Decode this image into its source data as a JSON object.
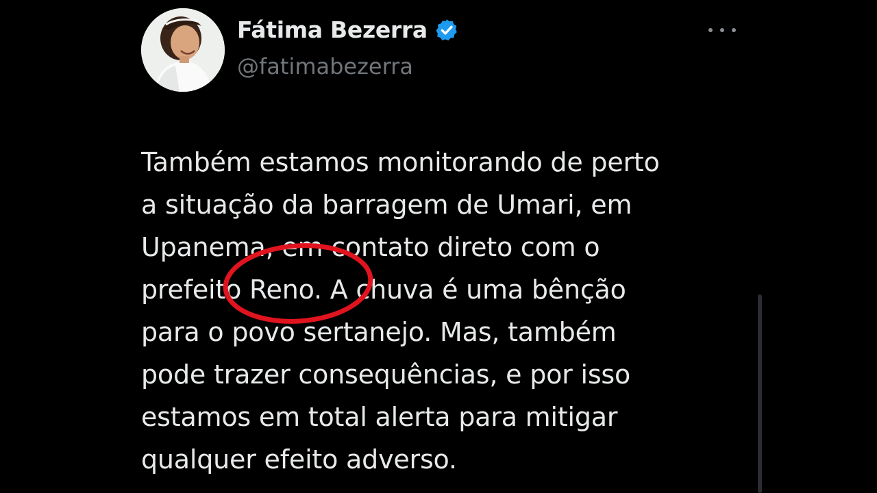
{
  "author": {
    "display_name": "Fátima Bezerra",
    "handle": "@fatimabezerra",
    "verified": true,
    "avatar_icon": "profile-photo"
  },
  "more_menu": {
    "icon": "more-horizontal-icon"
  },
  "tweet": {
    "lines": [
      "Também estamos monitorando de perto",
      "a situação da barragem de Umari, em",
      "Upanema, em contato direto com o",
      "prefeito Reno. A chuva é uma bênção",
      "para o povo sertanejo. Mas, também",
      "pode trazer consequências, e por isso",
      "estamos em total alerta para mitigar",
      "qualquer efeito adverso."
    ]
  },
  "colors": {
    "background": "#000000",
    "text_primary": "#e7e9ea",
    "text_secondary": "#71767b",
    "verified_badge": "#1d9bf0",
    "annotation_circle": "#e0141e"
  }
}
